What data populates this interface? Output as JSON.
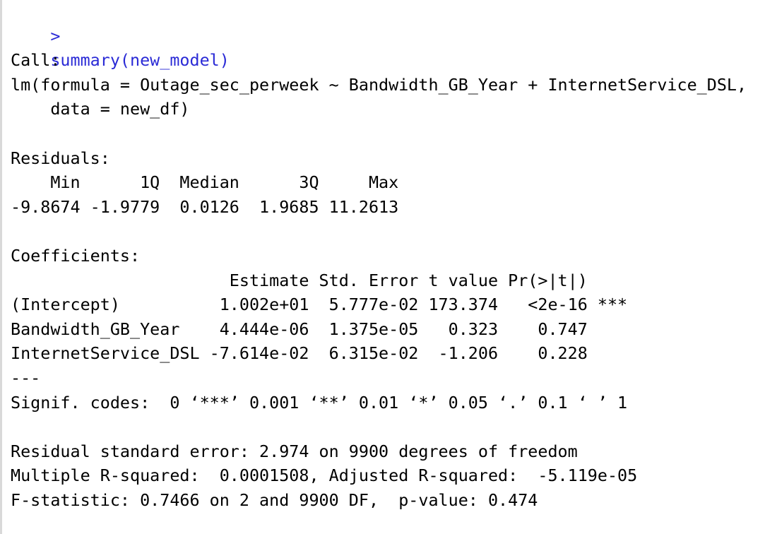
{
  "colors": {
    "prompt": "#2a2ad6",
    "output": "#000000",
    "background": "#ffffff"
  },
  "prompt_symbol": ">",
  "command": "summary(new_model)",
  "output_lines": [
    "",
    "Call:",
    "lm(formula = Outage_sec_perweek ~ Bandwidth_GB_Year + InternetService_DSL,",
    "    data = new_df)",
    "",
    "Residuals:",
    "    Min      1Q  Median      3Q     Max ",
    "-9.8674 -1.9779  0.0126  1.9685 11.2613 ",
    "",
    "Coefficients:",
    "                      Estimate Std. Error t value Pr(>|t|)    ",
    "(Intercept)          1.002e+01  5.777e-02 173.374   <2e-16 ***",
    "Bandwidth_GB_Year    4.444e-06  1.375e-05   0.323    0.747    ",
    "InternetService_DSL -7.614e-02  6.315e-02  -1.206    0.228    ",
    "---",
    "Signif. codes:  0 ‘***’ 0.001 ‘**’ 0.01 ‘*’ 0.05 ‘.’ 0.1 ‘ ’ 1",
    "",
    "Residual standard error: 2.974 on 9900 degrees of freedom",
    "Multiple R-squared:  0.0001508,\tAdjusted R-squared:  -5.119e-05 ",
    "F-statistic: 0.7466 on 2 and 9900 DF,  p-value: 0.474"
  ]
}
